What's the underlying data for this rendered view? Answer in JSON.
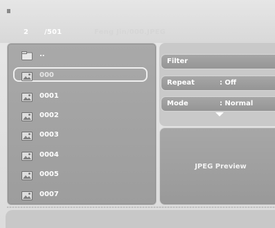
{
  "status": {
    "current": "2",
    "total": "/501",
    "path": "Feng Jin/000.JPEG"
  },
  "file_list": {
    "items": [
      {
        "label": "..",
        "icon": "folder-icon",
        "selected": false
      },
      {
        "label": "000",
        "icon": "image-file-icon",
        "selected": true
      },
      {
        "label": "0001",
        "icon": "image-file-icon",
        "selected": false
      },
      {
        "label": "0002",
        "icon": "image-file-icon",
        "selected": false
      },
      {
        "label": "0003",
        "icon": "image-file-icon",
        "selected": false
      },
      {
        "label": "0004",
        "icon": "image-file-icon",
        "selected": false
      },
      {
        "label": "0005",
        "icon": "image-file-icon",
        "selected": false
      },
      {
        "label": "0007",
        "icon": "image-file-icon",
        "selected": false
      }
    ]
  },
  "options": {
    "filter": {
      "label": "Filter"
    },
    "repeat": {
      "label": "Repeat",
      "value": ": Off"
    },
    "mode": {
      "label": "Mode",
      "value": ": Normal"
    }
  },
  "preview": {
    "label": "JPEG Preview"
  },
  "colors": {
    "panel": "#a3a3a3",
    "selection_border": "#efefef",
    "text": "#ffffff"
  }
}
